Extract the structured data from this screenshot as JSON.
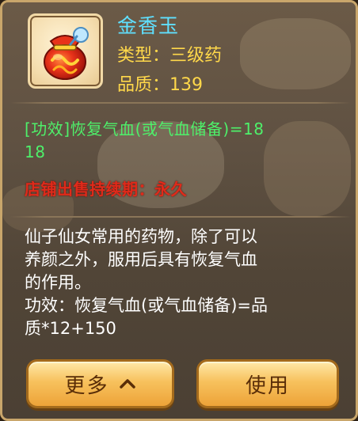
{
  "item": {
    "name": "金香玉",
    "type_text": "类型：三级药",
    "quality_text": "品质：139",
    "icon": "pouch-icon"
  },
  "effect": {
    "line1": "[功效]恢复气血(或气血储备)=18",
    "line2": "18"
  },
  "red_notice": "店铺出售持续期：永久",
  "description": {
    "line1": "仙子仙女常用的药物，除了可以",
    "line2": "养颜之外，服用后具有恢复气血",
    "line3": "的作用。",
    "line4": "功效：恢复气血(或气血储备)=品",
    "line5": "质*12+150"
  },
  "buttons": {
    "more_label": "更多",
    "use_label": "使用",
    "more_icon": "chevron-up-icon"
  },
  "colors": {
    "name": "#5fe0ff",
    "label": "#ffd84a",
    "effect": "#4ef06a",
    "notice": "#e02a1a"
  }
}
